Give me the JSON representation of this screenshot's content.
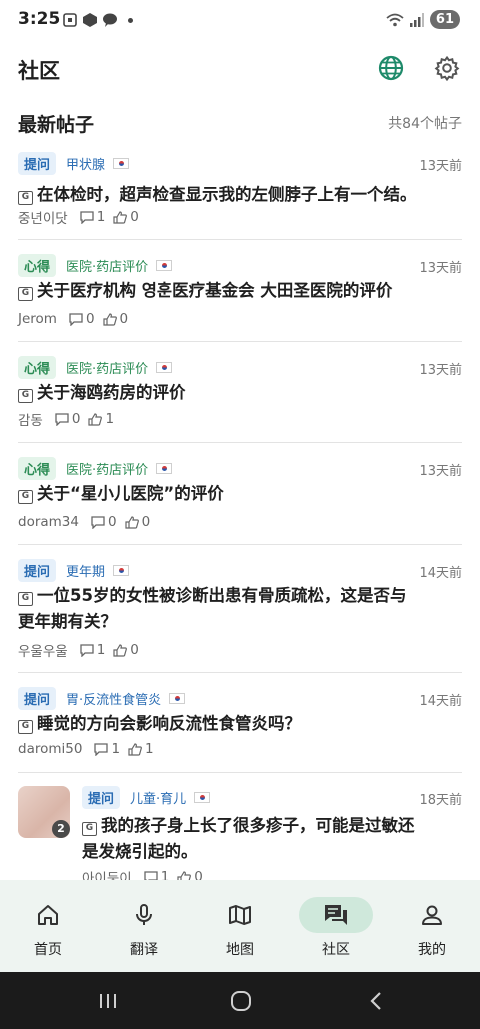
{
  "status_bar": {
    "time": "3:25",
    "battery": "61"
  },
  "header": {
    "title": "社区"
  },
  "section": {
    "title": "最新帖子",
    "count": "共84个帖子"
  },
  "posts": [
    {
      "badge": "提问",
      "badge_type": "q",
      "category": "甲状腺",
      "time": "13天前",
      "title": "在体检时，超声检查显示我的左侧脖子上有一个结。",
      "author": "중년이닷",
      "comments": "1",
      "likes": "0"
    },
    {
      "badge": "心得",
      "badge_type": "x",
      "category": "医院·药店评价",
      "time": "13天前",
      "title": "关于医疗机构 영훈医疗基金会 大田圣医院的评价",
      "author": "Jerom",
      "comments": "0",
      "likes": "0"
    },
    {
      "badge": "心得",
      "badge_type": "x",
      "category": "医院·药店评价",
      "time": "13天前",
      "title": "关于海鸥药房的评价",
      "author": "감동",
      "comments": "0",
      "likes": "1"
    },
    {
      "badge": "心得",
      "badge_type": "x",
      "category": "医院·药店评价",
      "time": "13天前",
      "title": "关于“星小儿医院”的评价",
      "author": "doram34",
      "comments": "0",
      "likes": "0"
    },
    {
      "badge": "提问",
      "badge_type": "q",
      "category": "更年期",
      "time": "14天前",
      "title_line1": "一位55岁的女性被诊断出患有骨质疏松，这是否与",
      "title_line2": "更年期有关？",
      "author": "우울우울",
      "comments": "1",
      "likes": "0"
    },
    {
      "badge": "提问",
      "badge_type": "q",
      "category": "胃·反流性食管炎",
      "time": "14天前",
      "title": "睡觉的方向会影响反流性食管炎吗？",
      "author": "daromi50",
      "comments": "1",
      "likes": "1"
    },
    {
      "badge": "提问",
      "badge_type": "q",
      "category": "儿童·育儿",
      "time": "18天前",
      "title_line1": "我的孩子身上长了很多疹子，可能是过敏还",
      "title_line2": "是发烧引起的。",
      "image_count": "2",
      "author": "아이둥이",
      "comments": "1",
      "likes": "0"
    }
  ],
  "bottom_nav": [
    {
      "label": "首页",
      "icon": "home-icon"
    },
    {
      "label": "翻译",
      "icon": "mic-icon"
    },
    {
      "label": "地图",
      "icon": "map-icon"
    },
    {
      "label": "社区",
      "icon": "chat-icon",
      "active": true
    },
    {
      "label": "我的",
      "icon": "person-icon"
    }
  ],
  "colors": {
    "accent": "#2c8c55",
    "question": "#2a6cb3",
    "nav_bg": "#eef4f1",
    "nav_active": "#cfe8db"
  }
}
